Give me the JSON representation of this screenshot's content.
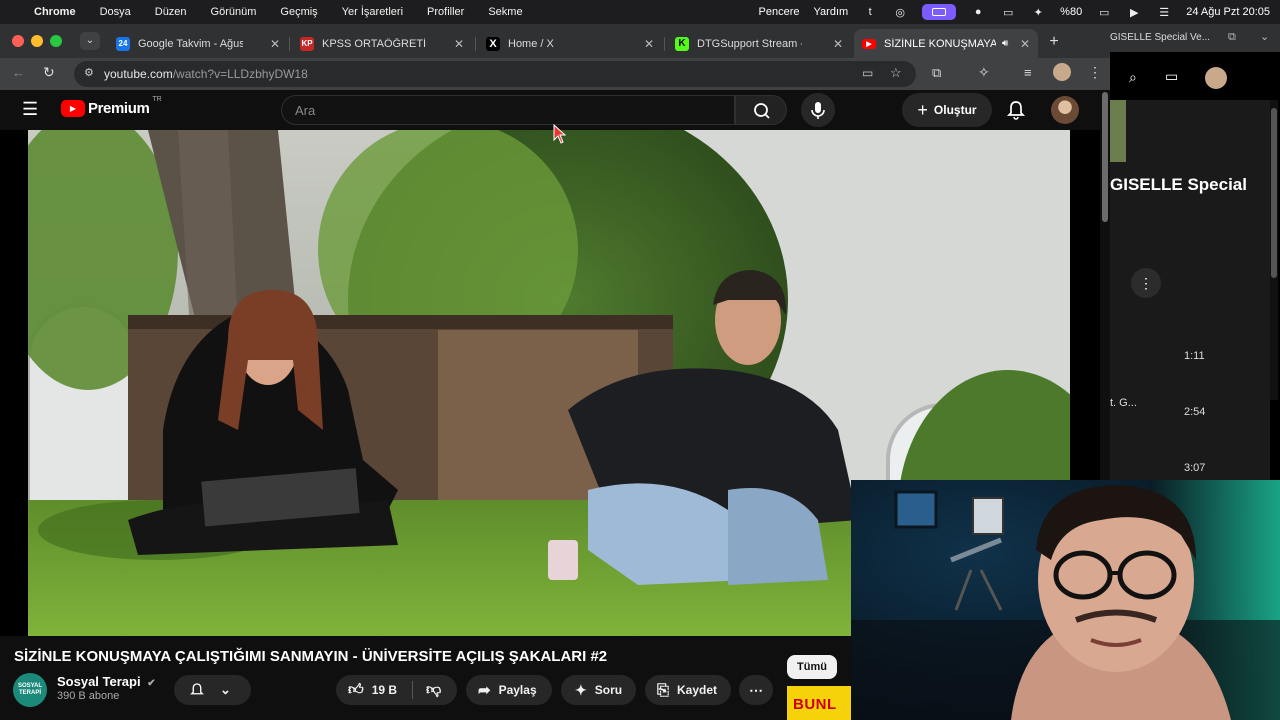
{
  "menubar": {
    "app": "Chrome",
    "items": [
      "Dosya",
      "Düzen",
      "Görünüm",
      "Geçmiş",
      "Yer İşaretleri",
      "Profiller",
      "Sekme"
    ],
    "right_items": [
      "Pencere",
      "Yardım"
    ],
    "battery": "%80",
    "clock": "24 Ağu Pzt  20:05",
    "t_icon": "t"
  },
  "tabs": [
    {
      "title": "Google Takvim - Ağustos",
      "favicon": "24",
      "color": "#1a73e8"
    },
    {
      "title": "KPSS ORTAÖĞRETİM E",
      "favicon": "KP",
      "color": "#c62828"
    },
    {
      "title": "Home / X",
      "favicon": "X",
      "color": "#000000"
    },
    {
      "title": "DTGSupport Stream - Wat",
      "favicon": "K",
      "color": "#53fc18"
    },
    {
      "title": "SİZİNLE KONUŞMAYA Ç",
      "favicon": "▶",
      "color": "#ff0000"
    }
  ],
  "address": {
    "host": "youtube.com",
    "path": "/watch?v=LLDzbhyDW18"
  },
  "youtube": {
    "logo": "Premium",
    "region": "TR",
    "search_placeholder": "Ara",
    "create_label": "Oluştur"
  },
  "video": {
    "title": "SİZİNLE KONUŞMAYA ÇALIŞTIĞIMI SANMAYIN - ÜNİVERSİTE AÇILIŞ ŞAKALARI #2",
    "channel": "Sosyal Terapi",
    "channel_avatar_text": "SOSYAL TERAPİ",
    "subscribers": "390 B abone",
    "likes": "19 B",
    "share_label": "Paylaş",
    "ask_label": "Soru",
    "save_label": "Kaydet"
  },
  "side": {
    "chip_all": "Tümü",
    "thumb_text": "BUNL",
    "behind_title": "GISELLE Special Ve...",
    "behind_heading": "GISELLE Special",
    "behind_snippet": "t. G...",
    "durations": [
      "1:11",
      "2:54",
      "3:07"
    ]
  },
  "colors": {
    "youtube_red": "#ff0000",
    "accent_purple": "#7c5cff"
  }
}
